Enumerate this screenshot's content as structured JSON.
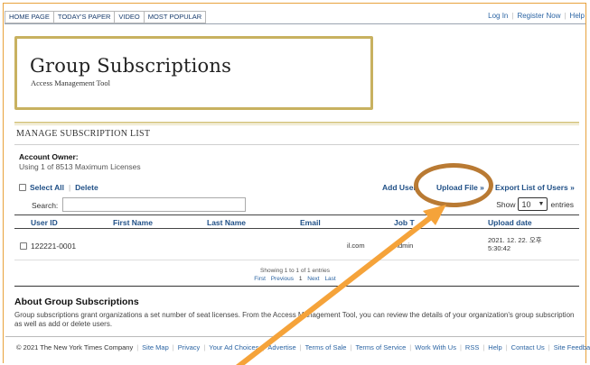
{
  "nav": {
    "tabs": [
      "HOME PAGE",
      "TODAY'S PAPER",
      "VIDEO",
      "MOST POPULAR"
    ],
    "account_links": [
      "Log In",
      "Register Now",
      "Help"
    ]
  },
  "banner": {
    "title": "Group Subscriptions",
    "subtitle": "Access Management Tool"
  },
  "section": {
    "title": "MANAGE SUBSCRIPTION LIST"
  },
  "owner": {
    "label": "Account Owner:",
    "value": "Using 1 of 8513 Maximum Licenses"
  },
  "list_actions": {
    "select_all": "Select All",
    "delete": "Delete",
    "add_user": "Add User",
    "upload_file": "Upload File »",
    "export": "Export List of Users »"
  },
  "search": {
    "label": "Search:",
    "value": ""
  },
  "entries": {
    "show": "Show",
    "value": "10",
    "suffix": "entries"
  },
  "table": {
    "columns": [
      "User ID",
      "First Name",
      "Last Name",
      "Email",
      "Job T",
      "Upload date"
    ],
    "rows": [
      {
        "user_id": "122221-0001",
        "first_name": "",
        "last_name": "",
        "email": "il.com",
        "job": "Admin",
        "upload_date_1": "2021. 12. 22. 오후",
        "upload_date_2": "5:30:42"
      }
    ]
  },
  "pagination": {
    "info": "Showing 1 to 1 of 1 entries",
    "first": "First",
    "previous": "Previous",
    "current": "1",
    "next": "Next",
    "last": "Last"
  },
  "about": {
    "title": "About Group Subscriptions",
    "text": "Group subscriptions grant organizations a set number of seat licenses. From the Access Management Tool, you can review the details of your organization's group subscription as well as add or delete users."
  },
  "footer": {
    "copyright": "© 2021 The New York Times Company",
    "links": [
      "Site Map",
      "Privacy",
      "Your Ad Choices",
      "Advertise",
      "Terms of Sale",
      "Terms of Service",
      "Work With Us",
      "RSS",
      "Help",
      "Contact Us",
      "Site Feedback"
    ]
  },
  "colors": {
    "annotation_circle": "#b97a33",
    "annotation_arrow": "#f5a33a",
    "link": "#1f4f86",
    "banner_border": "#c8b160"
  }
}
